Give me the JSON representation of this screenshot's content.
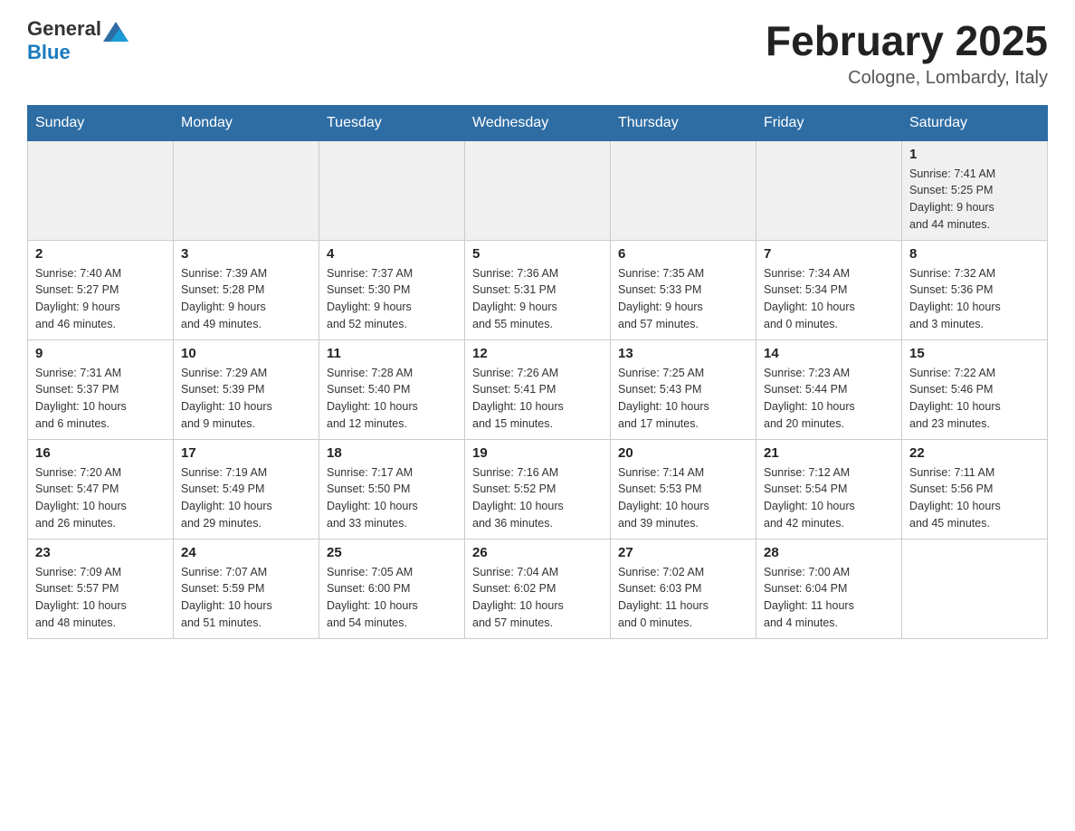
{
  "header": {
    "logo_text_general": "General",
    "logo_text_blue": "Blue",
    "calendar_title": "February 2025",
    "calendar_subtitle": "Cologne, Lombardy, Italy"
  },
  "days_of_week": [
    "Sunday",
    "Monday",
    "Tuesday",
    "Wednesday",
    "Thursday",
    "Friday",
    "Saturday"
  ],
  "weeks": [
    [
      {
        "day": "",
        "info": ""
      },
      {
        "day": "",
        "info": ""
      },
      {
        "day": "",
        "info": ""
      },
      {
        "day": "",
        "info": ""
      },
      {
        "day": "",
        "info": ""
      },
      {
        "day": "",
        "info": ""
      },
      {
        "day": "1",
        "info": "Sunrise: 7:41 AM\nSunset: 5:25 PM\nDaylight: 9 hours\nand 44 minutes."
      }
    ],
    [
      {
        "day": "2",
        "info": "Sunrise: 7:40 AM\nSunset: 5:27 PM\nDaylight: 9 hours\nand 46 minutes."
      },
      {
        "day": "3",
        "info": "Sunrise: 7:39 AM\nSunset: 5:28 PM\nDaylight: 9 hours\nand 49 minutes."
      },
      {
        "day": "4",
        "info": "Sunrise: 7:37 AM\nSunset: 5:30 PM\nDaylight: 9 hours\nand 52 minutes."
      },
      {
        "day": "5",
        "info": "Sunrise: 7:36 AM\nSunset: 5:31 PM\nDaylight: 9 hours\nand 55 minutes."
      },
      {
        "day": "6",
        "info": "Sunrise: 7:35 AM\nSunset: 5:33 PM\nDaylight: 9 hours\nand 57 minutes."
      },
      {
        "day": "7",
        "info": "Sunrise: 7:34 AM\nSunset: 5:34 PM\nDaylight: 10 hours\nand 0 minutes."
      },
      {
        "day": "8",
        "info": "Sunrise: 7:32 AM\nSunset: 5:36 PM\nDaylight: 10 hours\nand 3 minutes."
      }
    ],
    [
      {
        "day": "9",
        "info": "Sunrise: 7:31 AM\nSunset: 5:37 PM\nDaylight: 10 hours\nand 6 minutes."
      },
      {
        "day": "10",
        "info": "Sunrise: 7:29 AM\nSunset: 5:39 PM\nDaylight: 10 hours\nand 9 minutes."
      },
      {
        "day": "11",
        "info": "Sunrise: 7:28 AM\nSunset: 5:40 PM\nDaylight: 10 hours\nand 12 minutes."
      },
      {
        "day": "12",
        "info": "Sunrise: 7:26 AM\nSunset: 5:41 PM\nDaylight: 10 hours\nand 15 minutes."
      },
      {
        "day": "13",
        "info": "Sunrise: 7:25 AM\nSunset: 5:43 PM\nDaylight: 10 hours\nand 17 minutes."
      },
      {
        "day": "14",
        "info": "Sunrise: 7:23 AM\nSunset: 5:44 PM\nDaylight: 10 hours\nand 20 minutes."
      },
      {
        "day": "15",
        "info": "Sunrise: 7:22 AM\nSunset: 5:46 PM\nDaylight: 10 hours\nand 23 minutes."
      }
    ],
    [
      {
        "day": "16",
        "info": "Sunrise: 7:20 AM\nSunset: 5:47 PM\nDaylight: 10 hours\nand 26 minutes."
      },
      {
        "day": "17",
        "info": "Sunrise: 7:19 AM\nSunset: 5:49 PM\nDaylight: 10 hours\nand 29 minutes."
      },
      {
        "day": "18",
        "info": "Sunrise: 7:17 AM\nSunset: 5:50 PM\nDaylight: 10 hours\nand 33 minutes."
      },
      {
        "day": "19",
        "info": "Sunrise: 7:16 AM\nSunset: 5:52 PM\nDaylight: 10 hours\nand 36 minutes."
      },
      {
        "day": "20",
        "info": "Sunrise: 7:14 AM\nSunset: 5:53 PM\nDaylight: 10 hours\nand 39 minutes."
      },
      {
        "day": "21",
        "info": "Sunrise: 7:12 AM\nSunset: 5:54 PM\nDaylight: 10 hours\nand 42 minutes."
      },
      {
        "day": "22",
        "info": "Sunrise: 7:11 AM\nSunset: 5:56 PM\nDaylight: 10 hours\nand 45 minutes."
      }
    ],
    [
      {
        "day": "23",
        "info": "Sunrise: 7:09 AM\nSunset: 5:57 PM\nDaylight: 10 hours\nand 48 minutes."
      },
      {
        "day": "24",
        "info": "Sunrise: 7:07 AM\nSunset: 5:59 PM\nDaylight: 10 hours\nand 51 minutes."
      },
      {
        "day": "25",
        "info": "Sunrise: 7:05 AM\nSunset: 6:00 PM\nDaylight: 10 hours\nand 54 minutes."
      },
      {
        "day": "26",
        "info": "Sunrise: 7:04 AM\nSunset: 6:02 PM\nDaylight: 10 hours\nand 57 minutes."
      },
      {
        "day": "27",
        "info": "Sunrise: 7:02 AM\nSunset: 6:03 PM\nDaylight: 11 hours\nand 0 minutes."
      },
      {
        "day": "28",
        "info": "Sunrise: 7:00 AM\nSunset: 6:04 PM\nDaylight: 11 hours\nand 4 minutes."
      },
      {
        "day": "",
        "info": ""
      }
    ]
  ]
}
